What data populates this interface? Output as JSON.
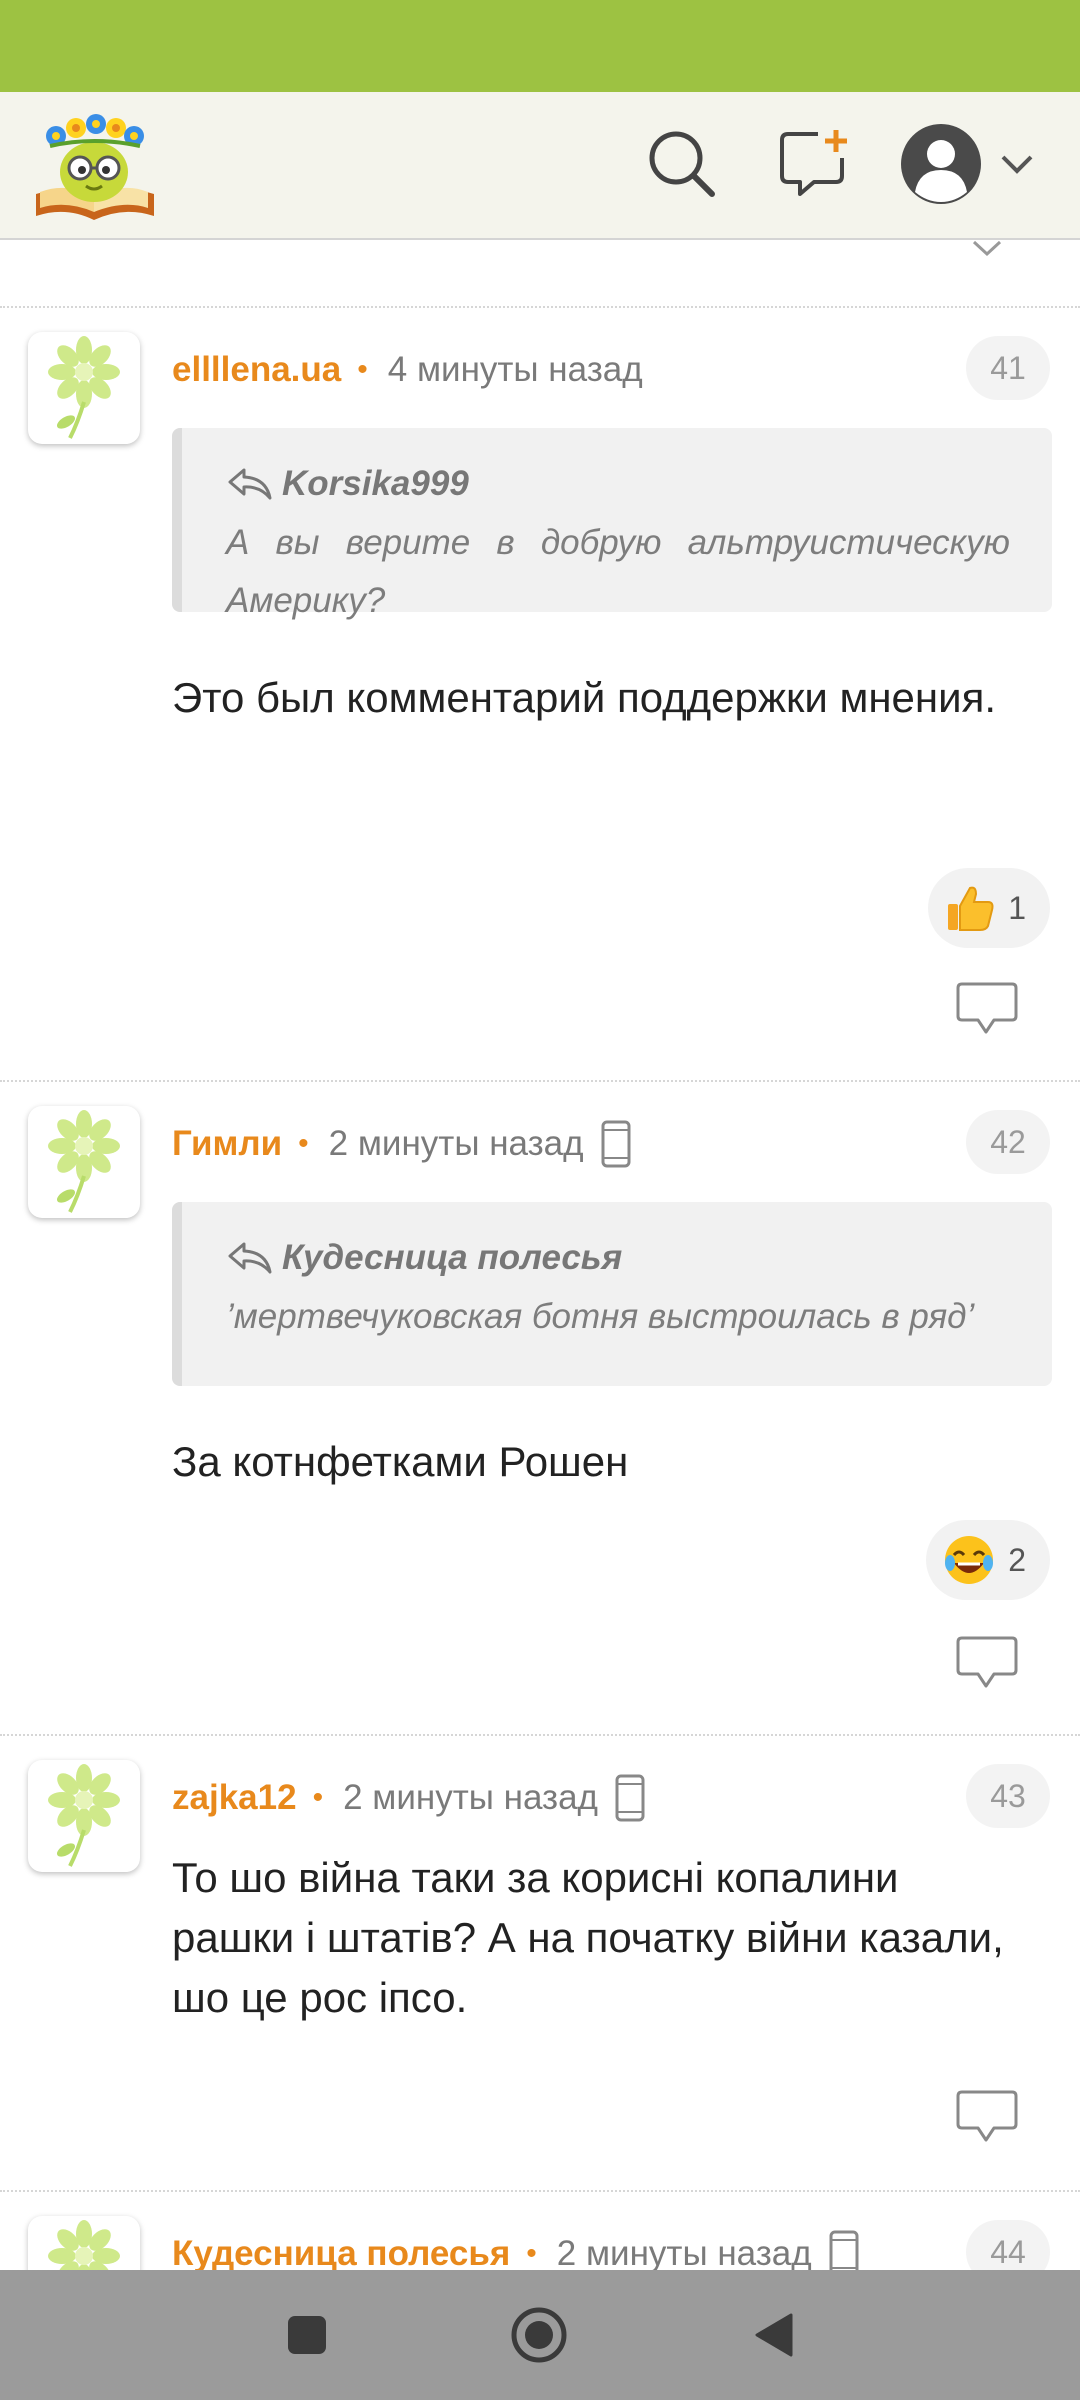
{
  "header": {
    "logo_name": "site-logo",
    "search_icon": "search-icon",
    "new_post_icon": "new-message-icon",
    "profile_icon": "user-avatar-icon",
    "accent_color": "#9dc242"
  },
  "comments": [
    {
      "author": "ellllena.ua",
      "time": "4 минуты назад",
      "number": "41",
      "mobile": false,
      "quote": {
        "author": "Korsika999",
        "text": "А вы верите в добрую альтруистическую Америку?"
      },
      "text": "Это был комментарий поддержки мнения.",
      "reaction": {
        "emoji": "thumbs-up",
        "count": "1"
      }
    },
    {
      "author": "Гимли",
      "time": "2 минуты назад",
      "number": "42",
      "mobile": true,
      "quote": {
        "author": "Кудесница полесья",
        "text": "’мертвечуковская ботня выстроилась в ряд’"
      },
      "text": "За котнфетками Рошен",
      "reaction": {
        "emoji": "laughing-face",
        "count": "2"
      }
    },
    {
      "author": "zajka12",
      "time": "2 минуты назад",
      "number": "43",
      "mobile": true,
      "text": "То шо війна таки за корисні копалини рашки і штатів? А на початку війни казали, шо це рос іпсо."
    },
    {
      "author": "Кудесница полесья",
      "time": "2 минуты назад",
      "number": "44",
      "mobile": true
    }
  ],
  "colors": {
    "author": "#e8891c",
    "status_bar": "#9dc242",
    "nav_bar": "#9b9b9b"
  }
}
